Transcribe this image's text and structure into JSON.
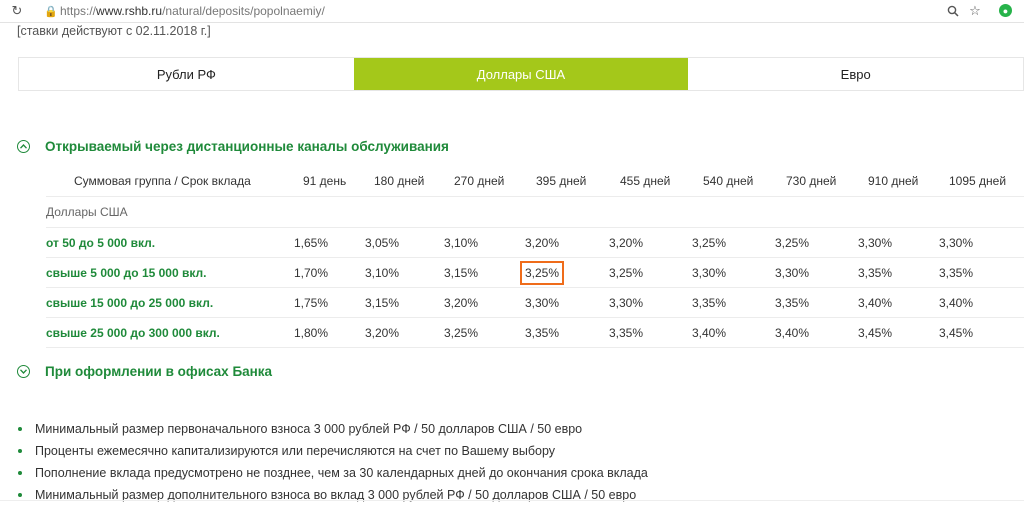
{
  "browser": {
    "url_scheme": "https://",
    "url_host": "www.rshb.ru",
    "url_path": "/natural/deposits/popolnaemiy/"
  },
  "rates_note": "[ставки действуют с 02.11.2018 г.]",
  "tabs": [
    {
      "label": "Рубли РФ"
    },
    {
      "label": "Доллары США"
    },
    {
      "label": "Евро"
    }
  ],
  "section_remote": {
    "title": "Открываемый через дистанционные каналы обслуживания"
  },
  "section_office": {
    "title": "При оформлении в офисах Банка"
  },
  "table": {
    "header_label": "Суммовая группа / Срок вклада",
    "terms": [
      "91 день",
      "180 дней",
      "270 дней",
      "395 дней",
      "455 дней",
      "540 дней",
      "730 дней",
      "910 дней",
      "1095 дней"
    ],
    "group_label": "Доллары США",
    "rows": [
      {
        "label": "от 50 до 5 000 вкл.",
        "rates": [
          "1,65%",
          "3,05%",
          "3,10%",
          "3,20%",
          "3,20%",
          "3,25%",
          "3,25%",
          "3,30%",
          "3,30%"
        ]
      },
      {
        "label": "свыше 5 000 до 15 000 вкл.",
        "rates": [
          "1,70%",
          "3,10%",
          "3,15%",
          "3,25%",
          "3,25%",
          "3,30%",
          "3,30%",
          "3,35%",
          "3,35%"
        ]
      },
      {
        "label": "свыше 15 000 до 25 000 вкл.",
        "rates": [
          "1,75%",
          "3,15%",
          "3,20%",
          "3,30%",
          "3,30%",
          "3,35%",
          "3,35%",
          "3,40%",
          "3,40%"
        ]
      },
      {
        "label": "свыше 25 000 до 300 000 вкл.",
        "rates": [
          "1,80%",
          "3,20%",
          "3,25%",
          "3,35%",
          "3,35%",
          "3,40%",
          "3,40%",
          "3,45%",
          "3,45%"
        ]
      }
    ]
  },
  "notes": [
    "Минимальный размер первоначального взноса 3 000 рублей РФ / 50 долларов США / 50 евро",
    "Проценты ежемесячно капитализируются или перечисляются на счет по Вашему выбору",
    "Пополнение вклада предусмотрено не позднее, чем за 30 календарных дней до окончания срока вклада",
    "Минимальный размер дополнительного взноса во вклад 3 000 рублей РФ / 50 долларов США / 50 евро"
  ],
  "colors": {
    "accent_green": "#1f8a3a",
    "tab_active": "#a4c81a",
    "highlight": "#ef6c1a"
  }
}
